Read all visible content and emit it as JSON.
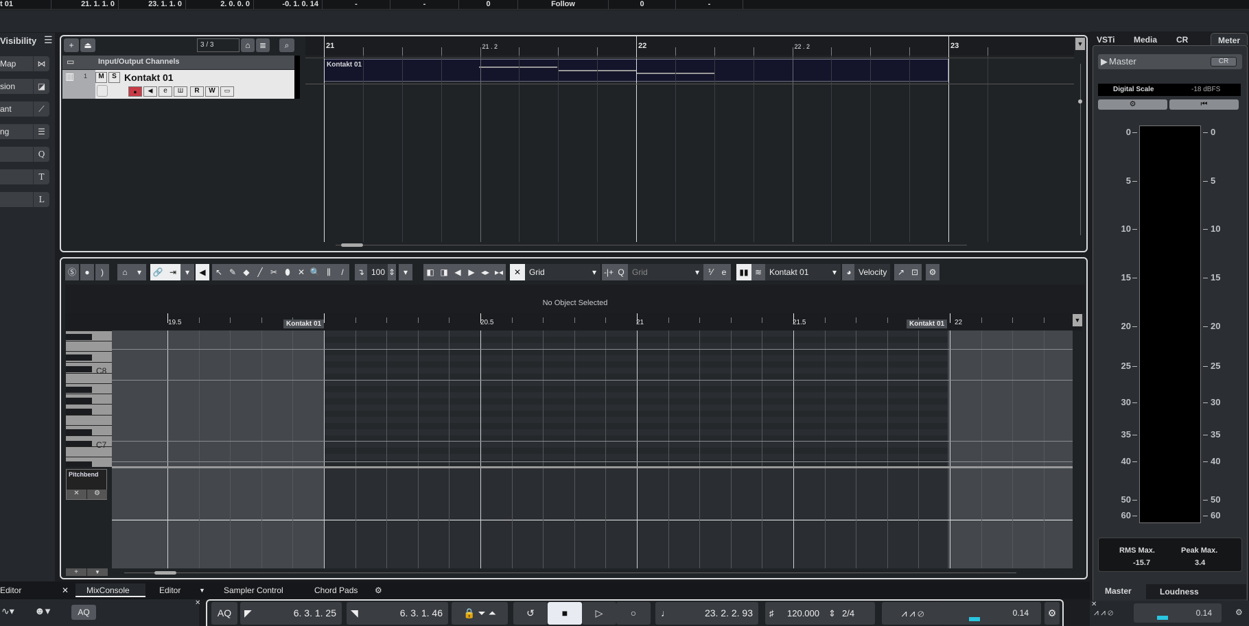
{
  "top_bar": {
    "cells": [
      "t 01",
      "21. 1. 1.   0",
      "23. 1. 1.   0",
      "2. 0. 0.   0",
      "-0. 1. 0. 14",
      "-",
      "-",
      "0",
      "Follow",
      "0",
      "-"
    ]
  },
  "left_panel": {
    "title": "Visibility",
    "menu_icon": "hamburger-icon",
    "items": [
      {
        "label": "Map",
        "icon": "bowtie-icon"
      },
      {
        "label": "sion",
        "icon": "triangle-fill-icon"
      },
      {
        "label": "ant",
        "icon": "quantize-icon"
      },
      {
        "label": "ng",
        "icon": "faders-icon"
      },
      {
        "label": "",
        "icon": "Q"
      },
      {
        "label": "",
        "icon": "T"
      },
      {
        "label": "",
        "icon": "L"
      }
    ]
  },
  "project": {
    "track_count": "3 / 3",
    "folder_track": "Input/Output Channels",
    "track": {
      "number": "1",
      "name": "Kontakt 01",
      "m": "M",
      "s": "S",
      "r": "R",
      "w": "W"
    },
    "ruler": [
      "21",
      "21 . 2",
      "22",
      "22 . 2",
      "23"
    ],
    "part_name": "Kontakt 01"
  },
  "editor": {
    "quantize_value": "100",
    "snap": "Grid",
    "quantize": "Grid",
    "instrument": "Kontakt 01",
    "controller": "Velocity",
    "info": "No Object Selected",
    "ruler": [
      "19.5",
      "20.5",
      "21",
      "21.5",
      "22"
    ],
    "part_start": "Kontakt 01",
    "part_end": "Kontakt 01",
    "keys": [
      "C8",
      "C7"
    ],
    "lane": "Pitchbend"
  },
  "tabs": {
    "left": "Editor",
    "items": [
      "MixConsole",
      "Editor",
      "Sampler Control",
      "Chord Pads"
    ],
    "right": [
      "Master",
      "Loudness"
    ]
  },
  "transport": {
    "aq": "AQ",
    "left_locator": "6. 3. 1. 25",
    "right_locator": "6. 3. 1. 46",
    "position": "23. 2. 2. 93",
    "tempo": "120.000",
    "signature": "2/4",
    "level": "0.14",
    "level2": "0.14",
    "aq_left": "AQ"
  },
  "right_panel": {
    "tabs": [
      "VSTi",
      "Media",
      "CR",
      "Meter"
    ],
    "active_tab": "Meter",
    "master": "Master",
    "cr": "CR",
    "scale_label": "Digital Scale",
    "scale_value": "-18 dBFS",
    "scale_marks": [
      "0",
      "5",
      "10",
      "15",
      "20",
      "25",
      "30",
      "35",
      "40",
      "50",
      "60"
    ],
    "rms_label": "RMS Max.",
    "rms_value": "-15.7",
    "peak_label": "Peak Max.",
    "peak_value": "3.4"
  },
  "colors": {
    "accent_cyan": "#29c6e0",
    "record": "#c83c46",
    "part_bg": "#14142a"
  }
}
